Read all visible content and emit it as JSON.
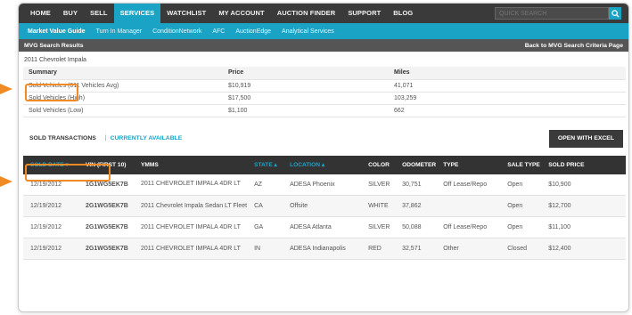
{
  "nav": {
    "items": [
      "HOME",
      "BUY",
      "SELL",
      "SERVICES",
      "WATCHLIST",
      "MY ACCOUNT",
      "AUCTION FINDER",
      "SUPPORT",
      "BLOG"
    ],
    "active_index": 3,
    "search_placeholder": "QUICK SEARCH"
  },
  "subnav": {
    "items": [
      "Market Value Guide",
      "Turn In Manager",
      "ConditionNetwork",
      "AFC",
      "AuctionEdge",
      "Analytical Services"
    ],
    "active_index": 0
  },
  "header": {
    "title": "MVG Search Results",
    "back_link": "Back to MVG Search Criteria Page"
  },
  "vehicle": "2011 Chevrolet Impala",
  "summary": {
    "headers": [
      "Summary",
      "Price",
      "Miles"
    ],
    "rows": [
      [
        "Sold Vehicles (611 Vehicles Avg)",
        "$10,919",
        "41,071"
      ],
      [
        "Sold Vehicles (High)",
        "$17,500",
        "103,259"
      ],
      [
        "Sold Vehicles (Low)",
        "$1,100",
        "662"
      ]
    ]
  },
  "tabs": {
    "sold": "SOLD TRANSACTIONS",
    "separator": "|",
    "available": "CURRENTLY AVAILABLE",
    "excel": "OPEN WITH EXCEL"
  },
  "transactions": {
    "headers": [
      "SOLD DATE ▾",
      "VIN (FIRST 10)",
      "YMMS",
      "STATE ▴",
      "LOCATION ▴",
      "COLOR",
      "ODOMETER",
      "TYPE",
      "SALE TYPE",
      "SOLD PRICE"
    ],
    "rows": [
      [
        "12/19/2012",
        "1G1WG5EK7B",
        "2011 CHEVROLET IMPALA 4DR LT",
        "AZ",
        "ADESA Phoenix",
        "SILVER",
        "30,751",
        "Off Lease/Repo",
        "Open",
        "$10,900"
      ],
      [
        "12/19/2012",
        "2G1WG5EK7B",
        "2011 Chevrolet Impala Sedan LT Fleet",
        "CA",
        "Offsite",
        "WHITE",
        "37,862",
        "",
        "Open",
        "$12,700"
      ],
      [
        "12/19/2012",
        "2G1WG5EK7B",
        "2011 CHEVROLET IMPALA 4DR LT",
        "GA",
        "ADESA Atlanta",
        "SILVER",
        "50,088",
        "Off Lease/Repo",
        "Open",
        "$11,100"
      ],
      [
        "12/19/2012",
        "2G1WG5EK7B",
        "2011 CHEVROLET IMPALA 4DR LT",
        "IN",
        "ADESA Indianapolis",
        "RED",
        "32,571",
        "Other",
        "Closed",
        "$12,400"
      ]
    ]
  },
  "colors": {
    "accent": "#1aa3c4",
    "nav_bg": "#3a3a3a",
    "callout": "#f08a24"
  }
}
